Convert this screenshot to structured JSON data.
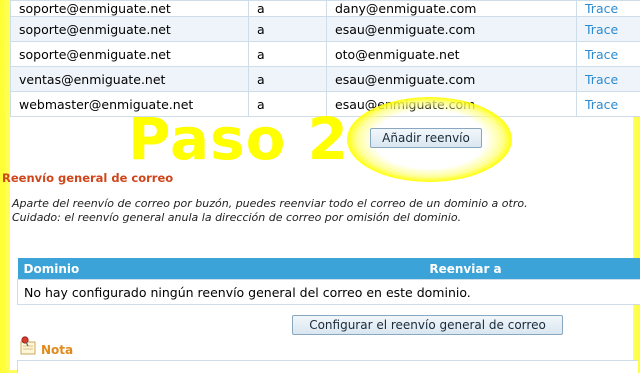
{
  "forwards": {
    "rows": [
      {
        "from": "soporte@enmiguate.net",
        "sep": "a",
        "to": "dany@enmiguate.com",
        "action": "Trace"
      },
      {
        "from": "soporte@enmiguate.net",
        "sep": "a",
        "to": "esau@enmiguate.com",
        "action": "Trace"
      },
      {
        "from": "soporte@enmiguate.net",
        "sep": "a",
        "to": "oto@enmiguate.net",
        "action": "Trace"
      },
      {
        "from": "ventas@enmiguate.net",
        "sep": "a",
        "to": "esau@enmiguate.com",
        "action": "Trace"
      },
      {
        "from": "webmaster@enmiguate.net",
        "sep": "a",
        "to": "esau@enmiguate.com",
        "action": "Trace"
      }
    ],
    "add_button": "Añadir reenvío"
  },
  "annotation": {
    "step": "Paso 2"
  },
  "general_forward": {
    "title": "Reenvío general de correo",
    "desc_line1": "Aparte del reenvío de correo por buzón, puedes reenviar todo el correo de un dominio a otro.",
    "desc_line2": "Cuidado: el reenvío general anula la dirección de correo por omisión del dominio.",
    "col_domain": "Dominio",
    "col_forward": "Reenviar a",
    "empty_message": "No hay configurado ningún reenvío general del correo en este dominio.",
    "config_button": "Configurar el reenvío general de correo"
  },
  "note": {
    "title": "Nota",
    "icon": "note-pin-icon"
  },
  "colors": {
    "highlight": "#ffff33",
    "link": "#2b8bd0",
    "section_title": "#d0451a",
    "table_header": "#3ba3d8",
    "note_title": "#e08a1a"
  }
}
